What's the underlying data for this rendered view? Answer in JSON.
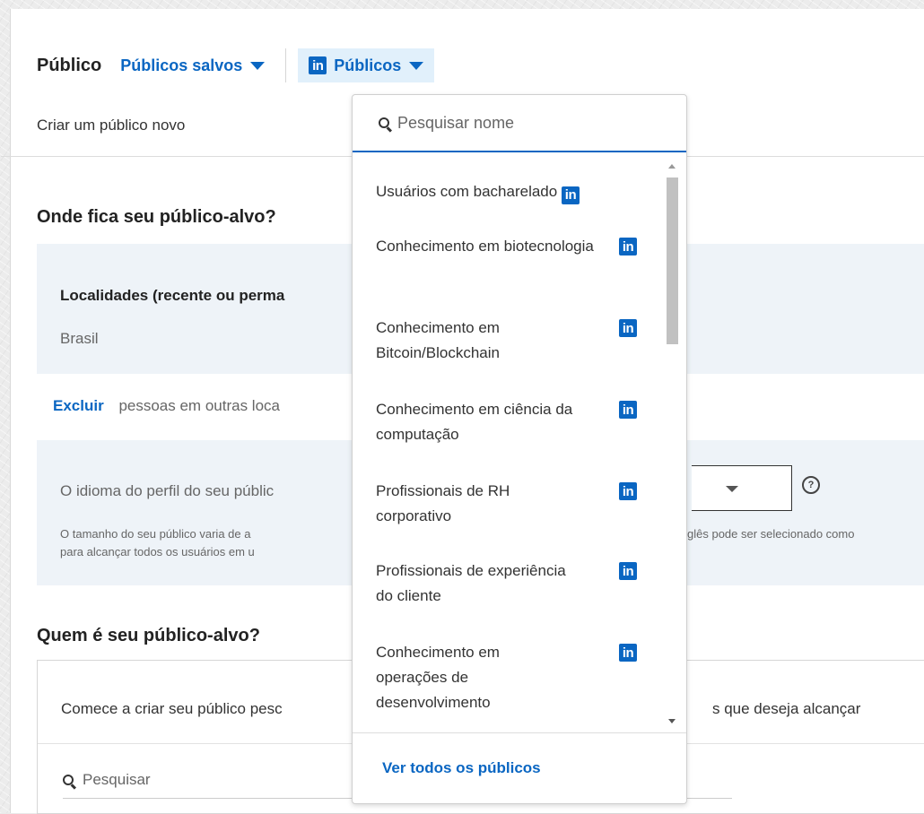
{
  "header": {
    "title": "Público",
    "saved_audiences": "Públicos salvos",
    "audiences_button": "Públicos",
    "create_new": "Criar um público novo"
  },
  "location_section": {
    "title": "Onde fica seu público-alvo?",
    "label": "Localidades (recente ou perma",
    "value": "Brasil",
    "exclude_link": "Excluir",
    "exclude_text": "pessoas em outras loca"
  },
  "language_section": {
    "label": "O idioma do perfil do seu públic",
    "note_line1": "O tamanho do seu público varia de a",
    "note_line2": "para alcançar todos os usuários em u",
    "note_right": "glês pode ser selecionado como"
  },
  "who_section": {
    "title": "Quem é seu público-alvo?",
    "build_text": "Comece a criar seu público pesc",
    "build_text_right": "s que deseja alcançar",
    "search_placeholder": "Pesquisar"
  },
  "dropdown": {
    "search_placeholder": "Pesquisar nome",
    "items": [
      {
        "label": "Usuários com bacharelado"
      },
      {
        "label": "Conhecimento em biotecnologia"
      },
      {
        "label": "Conhecimento em Bitcoin/Blockchain"
      },
      {
        "label": "Conhecimento em ciência da computação"
      },
      {
        "label": "Profissionais de RH corporativo"
      },
      {
        "label": "Profissionais de experiência do cliente"
      },
      {
        "label": "Conhecimento em operações de desenvolvimento"
      }
    ],
    "see_all": "Ver todos os públicos"
  },
  "icons": {
    "linkedin_logo_text": "in",
    "help": "?"
  },
  "colors": {
    "brand_blue": "#0a66c2",
    "panel_bg": "#eef3f8",
    "button_highlight": "#e1f0fb"
  }
}
